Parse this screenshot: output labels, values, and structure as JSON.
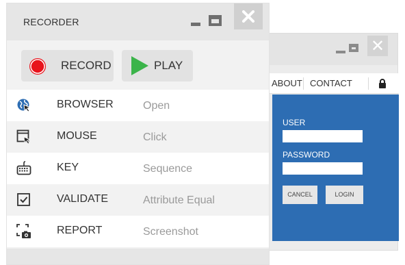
{
  "background_window": {
    "nav": {
      "about": "ABOUT",
      "contact": "CONTACT"
    },
    "login": {
      "user_label": "USER",
      "password_label": "PASSWORD",
      "user_value": "",
      "password_value": "",
      "cancel_label": "CANCEL",
      "login_label": "LOGIN",
      "panel_color": "#2d6db3"
    }
  },
  "recorder": {
    "title": "RECORDER",
    "toolbar": {
      "record_label": "RECORD",
      "play_label": "PLAY",
      "record_icon": "record-icon",
      "play_icon": "play-icon",
      "record_color": "#e8141c",
      "play_color": "#3bb44a"
    },
    "rows": [
      {
        "icon": "globe-cursor-icon",
        "name": "BROWSER",
        "action": "Open"
      },
      {
        "icon": "mouse-window-icon",
        "name": "MOUSE",
        "action": "Click"
      },
      {
        "icon": "keyboard-icon",
        "name": "KEY",
        "action": "Sequence"
      },
      {
        "icon": "checkbox-icon",
        "name": "VALIDATE",
        "action": "Attribute Equal"
      },
      {
        "icon": "screenshot-camera-icon",
        "name": "REPORT",
        "action": "Screenshot"
      }
    ]
  }
}
